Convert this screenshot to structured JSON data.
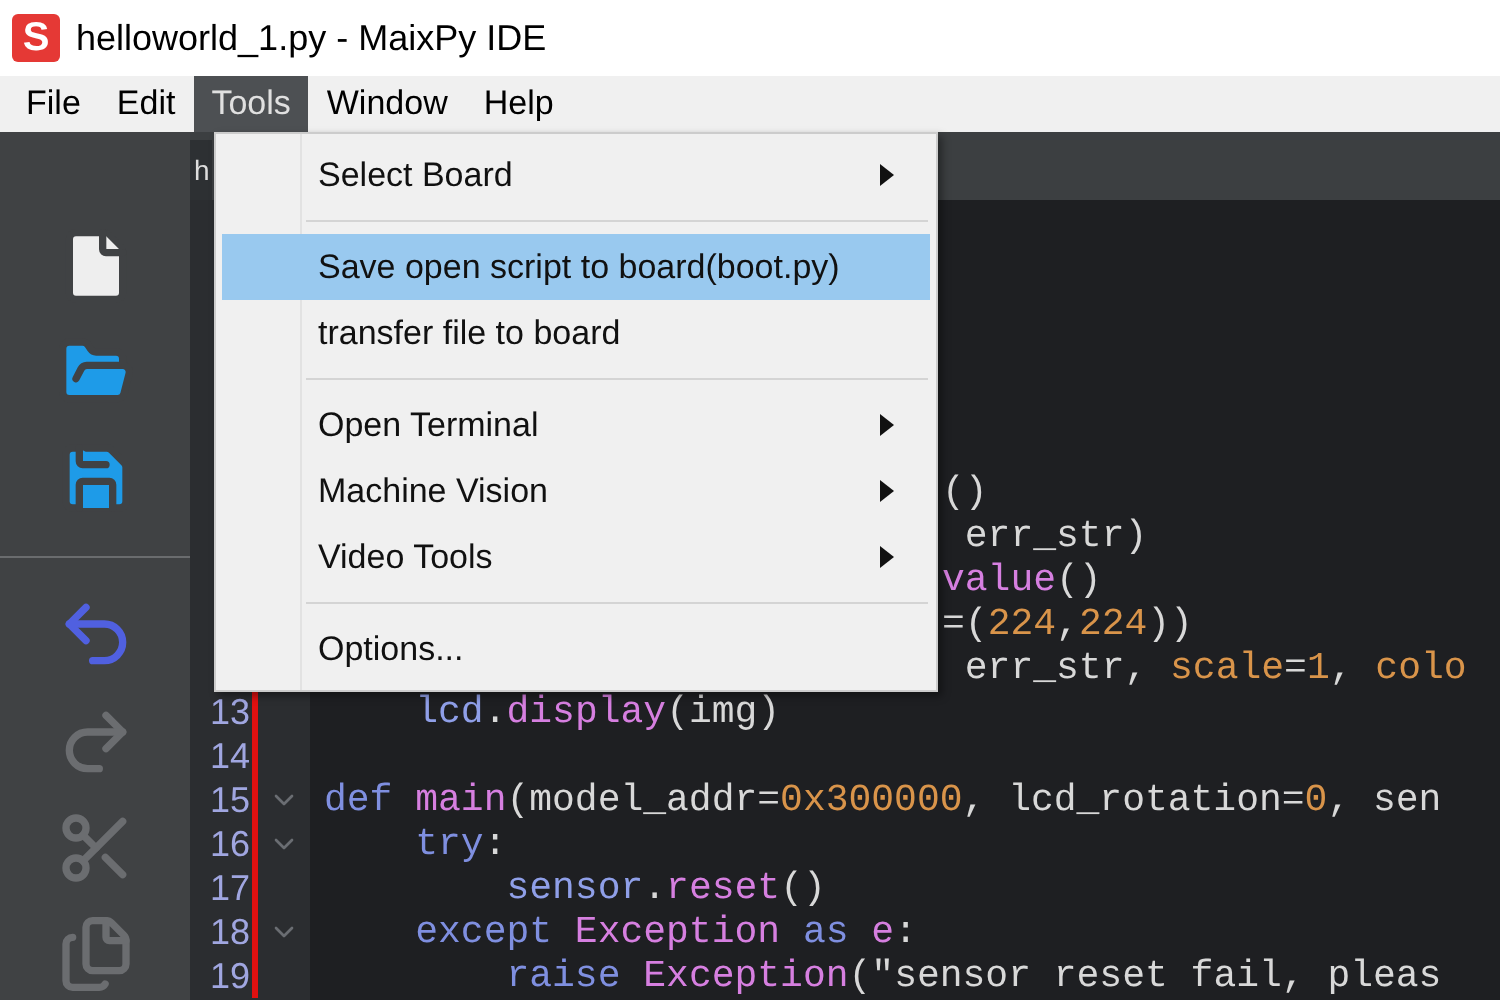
{
  "window": {
    "logo_text": "S",
    "title": "helloworld_1.py - MaixPy IDE"
  },
  "menu_bar": [
    {
      "label": "File",
      "selected": false
    },
    {
      "label": "Edit",
      "selected": false
    },
    {
      "label": "Tools",
      "selected": true
    },
    {
      "label": "Window",
      "selected": false
    },
    {
      "label": "Help",
      "selected": false
    }
  ],
  "toolbar": [
    {
      "kind": "new",
      "disabled": false
    },
    {
      "kind": "open",
      "disabled": false
    },
    {
      "kind": "save",
      "disabled": false
    },
    {
      "kind": "separator"
    },
    {
      "kind": "undo",
      "disabled": false
    },
    {
      "kind": "redo",
      "disabled": true
    },
    {
      "kind": "cut",
      "disabled": true
    },
    {
      "kind": "copy",
      "disabled": true
    }
  ],
  "editor_tab": {
    "label": "h"
  },
  "code_lines": [
    {
      "covered": true,
      "fold": false,
      "tokens": [
        {
          "text": "()",
          "kind": "plain"
        }
      ]
    },
    {
      "covered": true,
      "fold": false,
      "tokens": [
        {
          "text": " err_str)",
          "kind": "plain"
        }
      ]
    },
    {
      "covered": true,
      "fold": false,
      "tokens": [
        {
          "text": "value",
          "kind": "func"
        },
        {
          "text": "()",
          "kind": "plain"
        }
      ]
    },
    {
      "covered": true,
      "fold": false,
      "tokens": [
        {
          "text": "=(",
          "kind": "plain"
        },
        {
          "text": "224",
          "kind": "number"
        },
        {
          "text": ",",
          "kind": "plain"
        },
        {
          "text": "224",
          "kind": "number"
        },
        {
          "text": "))",
          "kind": "plain"
        }
      ]
    },
    {
      "covered": true,
      "fold": false,
      "tokens": [
        {
          "text": " err_str, ",
          "kind": "plain"
        },
        {
          "text": "scale",
          "kind": "number"
        },
        {
          "text": "=",
          "kind": "plain"
        },
        {
          "text": "1",
          "kind": "number"
        },
        {
          "text": ", ",
          "kind": "plain"
        },
        {
          "text": "colo",
          "kind": "number"
        }
      ]
    },
    {
      "covered": false,
      "number": "13",
      "fold": false,
      "tokens": [
        {
          "text": "    lcd",
          "kind": "var"
        },
        {
          "text": ".",
          "kind": "plain"
        },
        {
          "text": "display",
          "kind": "func"
        },
        {
          "text": "(img)",
          "kind": "plain"
        }
      ]
    },
    {
      "covered": false,
      "number": "14",
      "fold": false
    },
    {
      "covered": false,
      "number": "15",
      "fold": true,
      "tokens": [
        {
          "text": "def ",
          "kind": "keyword"
        },
        {
          "text": "main",
          "kind": "func"
        },
        {
          "text": "(model_addr=",
          "kind": "plain"
        },
        {
          "text": "0x300000",
          "kind": "number"
        },
        {
          "text": ", lcd_rotation=",
          "kind": "plain"
        },
        {
          "text": "0",
          "kind": "number"
        },
        {
          "text": ", sen",
          "kind": "plain"
        }
      ]
    },
    {
      "covered": false,
      "number": "16",
      "fold": true,
      "tokens": [
        {
          "text": "    try",
          "kind": "keyword"
        },
        {
          "text": ":",
          "kind": "plain"
        }
      ]
    },
    {
      "covered": false,
      "number": "17",
      "fold": false,
      "tokens": [
        {
          "text": "        sensor",
          "kind": "var"
        },
        {
          "text": ".",
          "kind": "plain"
        },
        {
          "text": "reset",
          "kind": "func"
        },
        {
          "text": "()",
          "kind": "plain"
        }
      ]
    },
    {
      "covered": false,
      "number": "18",
      "fold": true,
      "tokens": [
        {
          "text": "    except ",
          "kind": "keyword"
        },
        {
          "text": "Exception",
          "kind": "func"
        },
        {
          "text": " as ",
          "kind": "keyword"
        },
        {
          "text": "e",
          "kind": "func"
        },
        {
          "text": ":",
          "kind": "plain"
        }
      ]
    },
    {
      "covered": false,
      "number": "19",
      "fold": false,
      "tokens": [
        {
          "text": "        raise ",
          "kind": "keyword"
        },
        {
          "text": "Exception",
          "kind": "func"
        },
        {
          "text": "(\"sensor reset fail, pleas",
          "kind": "plain"
        }
      ]
    }
  ],
  "tools_menu": [
    {
      "kind": "item",
      "label": "Select Board",
      "submenu": true,
      "selected": false
    },
    {
      "kind": "separator"
    },
    {
      "kind": "item",
      "label": "Save open script to board(boot.py)",
      "submenu": false,
      "selected": true
    },
    {
      "kind": "item",
      "label": "transfer file to board",
      "submenu": false,
      "selected": false
    },
    {
      "kind": "separator"
    },
    {
      "kind": "item",
      "label": "Open Terminal",
      "submenu": true,
      "selected": false
    },
    {
      "kind": "item",
      "label": "Machine Vision",
      "submenu": true,
      "selected": false
    },
    {
      "kind": "item",
      "label": "Video Tools",
      "submenu": true,
      "selected": false
    },
    {
      "kind": "separator"
    },
    {
      "kind": "item",
      "label": "Options...",
      "submenu": false,
      "selected": false
    }
  ]
}
